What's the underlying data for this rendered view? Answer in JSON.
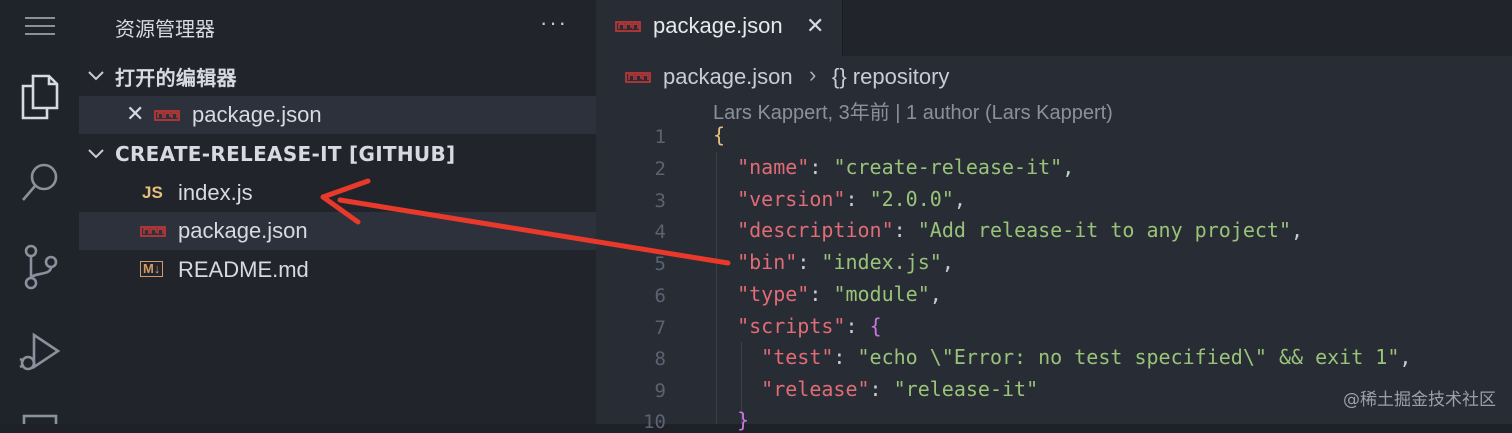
{
  "sidebar": {
    "title": "资源管理器",
    "more": "···",
    "open_editors": {
      "label": "打开的编辑器",
      "files": [
        {
          "name": "package.json",
          "icon": "npm-icon"
        }
      ]
    },
    "project": {
      "label": "CREATE-RELEASE-IT [GITHUB]",
      "files": [
        {
          "name": "index.js",
          "icon_text": "JS"
        },
        {
          "name": "package.json",
          "icon": "npm-icon"
        },
        {
          "name": "README.md",
          "icon_text": "M↓"
        }
      ]
    }
  },
  "editor": {
    "tab": {
      "label": "package.json",
      "close": "✕"
    },
    "breadcrumb": {
      "file": "package.json",
      "separator": "›",
      "symbol": "{} repository"
    },
    "blame": "Lars Kappert, 3年前 | 1 author (Lars Kappert)",
    "line_numbers": [
      "1",
      "2",
      "3",
      "4",
      "5",
      "6",
      "7",
      "8",
      "9",
      "10"
    ],
    "code": {
      "l1": "{",
      "l2_key": "\"name\"",
      "l2_val": "\"create-release-it\"",
      "l3_key": "\"version\"",
      "l3_val": "\"2.0.0\"",
      "l4_key": "\"description\"",
      "l4_val": "\"Add release-it to any project\"",
      "l5_key": "\"bin\"",
      "l5_val": "\"index.js\"",
      "l6_key": "\"type\"",
      "l6_val": "\"module\"",
      "l7_key": "\"scripts\"",
      "l7_val": "{",
      "l8_key": "\"test\"",
      "l8_val": "\"echo \\\"Error: no test specified\\\" && exit 1\"",
      "l9_key": "\"release\"",
      "l9_val": "\"release-it\"",
      "l10": "}"
    }
  },
  "watermark": "@稀土掘金技术社区",
  "colors": {
    "accent_arrow": "#e8392b",
    "npm_red": "#cb3837",
    "js_yellow": "#e5c07b"
  }
}
